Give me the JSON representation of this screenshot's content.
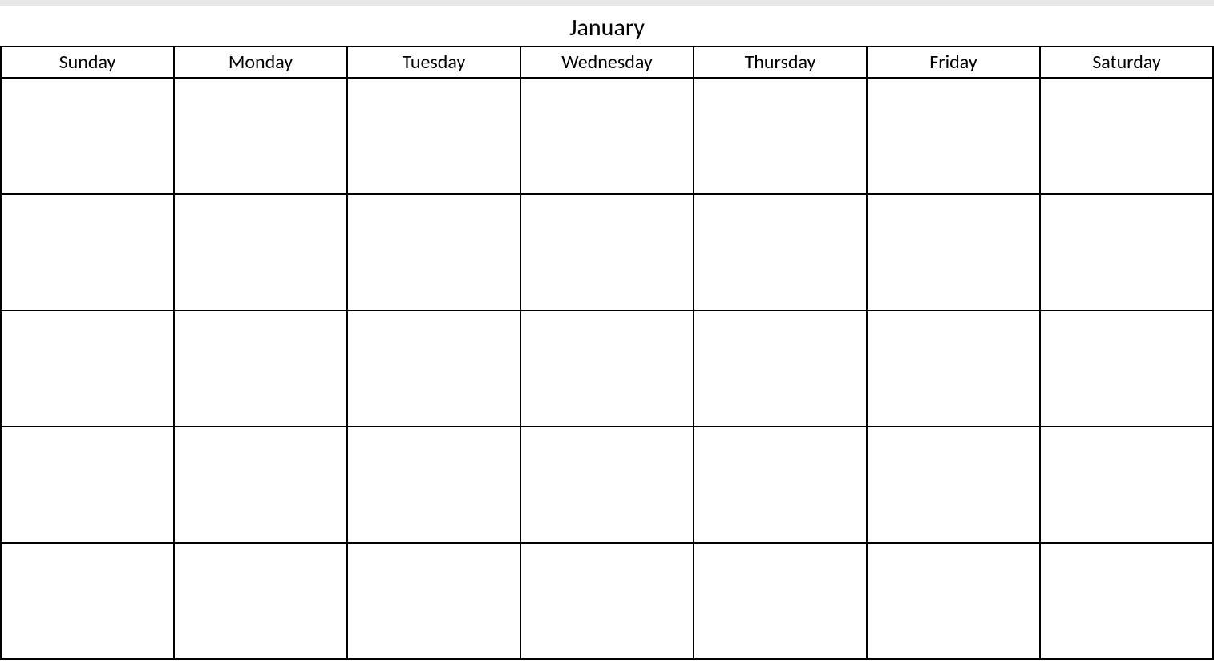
{
  "calendar": {
    "month_title": "January",
    "day_headers": [
      "Sunday",
      "Monday",
      "Tuesday",
      "Wednesday",
      "Thursday",
      "Friday",
      "Saturday"
    ],
    "rows": 5,
    "columns": 7
  }
}
